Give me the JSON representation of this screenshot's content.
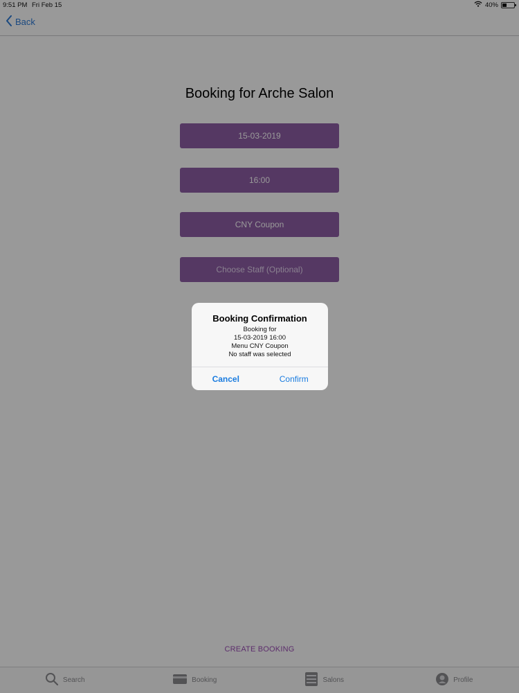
{
  "status_bar": {
    "time": "9:51 PM",
    "date": "Fri Feb 15",
    "battery": "40%",
    "battery_level": 0.4
  },
  "nav": {
    "back_label": "Back"
  },
  "page": {
    "title": "Booking for Arche Salon"
  },
  "form": {
    "date_value": "15-03-2019",
    "time_value": "16:00",
    "menu_value": "CNY Coupon",
    "staff_placeholder": "Choose Staff (Optional)"
  },
  "actions": {
    "create_booking": "CREATE BOOKING"
  },
  "tabs": [
    {
      "label": "Search",
      "icon": "search-icon"
    },
    {
      "label": "Booking",
      "icon": "booking-icon"
    },
    {
      "label": "Salons",
      "icon": "salons-icon"
    },
    {
      "label": "Profile",
      "icon": "profile-icon"
    }
  ],
  "dialog": {
    "title": "Booking Confirmation",
    "lines": [
      "Booking for",
      "15-03-2019 16:00",
      "Menu CNY Coupon",
      "No staff was selected"
    ],
    "cancel_label": "Cancel",
    "confirm_label": "Confirm"
  },
  "colors": {
    "accent_purple": "#8e5ea6",
    "link_blue": "#1a7ce0",
    "create_text": "#9b4db5"
  }
}
